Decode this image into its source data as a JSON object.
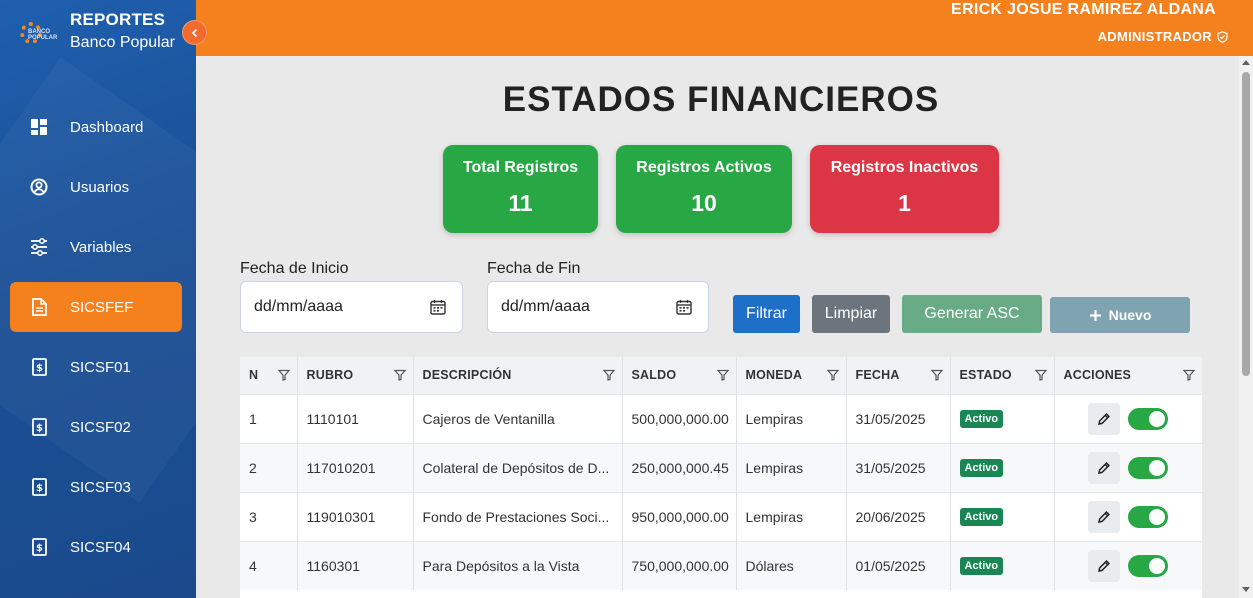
{
  "brand": {
    "title": "REPORTES",
    "subtitle": "Banco Popular",
    "logo_text": "BANCO POPULAR"
  },
  "header": {
    "user_name": "ERICK JOSUE RAMIREZ ALDANA",
    "user_role": "ADMINISTRADOR"
  },
  "sidebar": {
    "items": [
      {
        "label": "Dashboard",
        "icon": "dashboard-icon"
      },
      {
        "label": "Usuarios",
        "icon": "user-circle-icon"
      },
      {
        "label": "Variables",
        "icon": "sliders-icon"
      },
      {
        "label": "SICSFEF",
        "icon": "document-icon",
        "active": true
      },
      {
        "label": "SICSF01",
        "icon": "money-file-icon"
      },
      {
        "label": "SICSF02",
        "icon": "money-file-icon"
      },
      {
        "label": "SICSF03",
        "icon": "money-file-icon"
      },
      {
        "label": "SICSF04",
        "icon": "money-file-icon"
      }
    ]
  },
  "page": {
    "title": "ESTADOS FINANCIEROS"
  },
  "stats": {
    "total": {
      "label": "Total Registros",
      "value": "11"
    },
    "active": {
      "label": "Registros Activos",
      "value": "10"
    },
    "inactive": {
      "label": "Registros Inactivos",
      "value": "1"
    }
  },
  "filters": {
    "start_label": "Fecha de Inicio",
    "start_placeholder": "dd/mm/aaaa",
    "end_label": "Fecha de Fin",
    "end_placeholder": "dd/mm/aaaa",
    "filter_btn": "Filtrar",
    "clear_btn": "Limpiar",
    "asc_btn": "Generar ASC",
    "new_btn": "Nuevo"
  },
  "table": {
    "columns": [
      "N",
      "RUBRO",
      "DESCRIPCIÓN",
      "SALDO",
      "MONEDA",
      "FECHA",
      "ESTADO",
      "ACCIONES"
    ],
    "rows": [
      {
        "n": "1",
        "rubro": "1110101",
        "descripcion": "Cajeros de Ventanilla",
        "saldo": "500,000,000.00",
        "moneda": "Lempiras",
        "fecha": "31/05/2025",
        "estado": "Activo"
      },
      {
        "n": "2",
        "rubro": "117010201",
        "descripcion": "Colateral de Depósitos de D...",
        "saldo": "250,000,000.45",
        "moneda": "Lempiras",
        "fecha": "31/05/2025",
        "estado": "Activo"
      },
      {
        "n": "3",
        "rubro": "119010301",
        "descripcion": "Fondo de Prestaciones Soci...",
        "saldo": "950,000,000.00",
        "moneda": "Lempiras",
        "fecha": "20/06/2025",
        "estado": "Activo"
      },
      {
        "n": "4",
        "rubro": "1160301",
        "descripcion": "Para Depósitos a la Vista",
        "saldo": "750,000,000.00",
        "moneda": "Dólares",
        "fecha": "01/05/2025",
        "estado": "Activo"
      }
    ]
  },
  "colors": {
    "orange": "#f5811e",
    "sidebar_blue": "#1b4f95",
    "green": "#27a844",
    "red": "#dc3545",
    "primary": "#1d6fc8"
  }
}
